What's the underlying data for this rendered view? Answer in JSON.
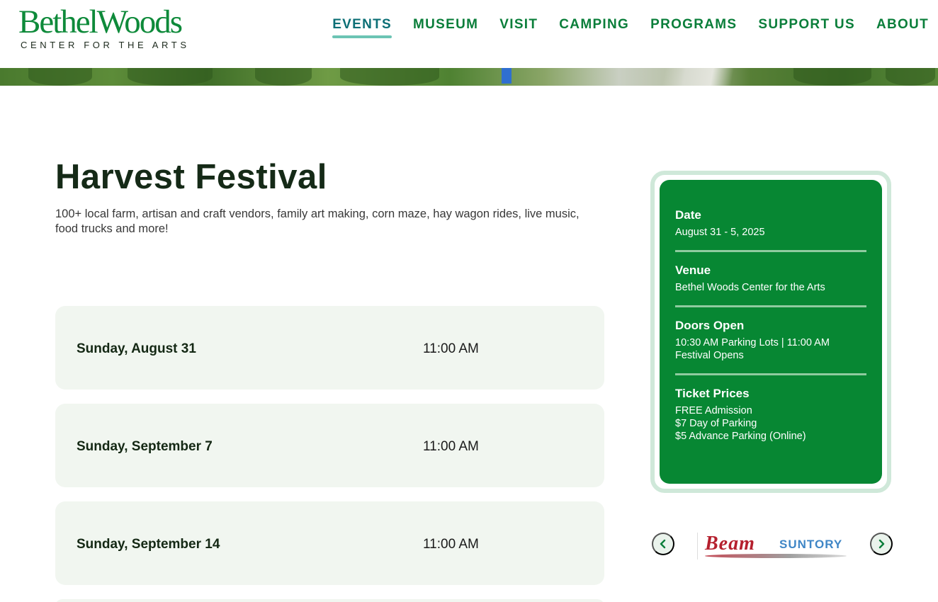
{
  "brand": {
    "name": "BethelWoods",
    "tagline": "CENTER FOR THE ARTS"
  },
  "nav": {
    "items": [
      {
        "label": "EVENTS",
        "active": true
      },
      {
        "label": "MUSEUM"
      },
      {
        "label": "VISIT"
      },
      {
        "label": "CAMPING"
      },
      {
        "label": "PROGRAMS"
      },
      {
        "label": "SUPPORT US"
      },
      {
        "label": "ABOUT"
      }
    ]
  },
  "event": {
    "title": "Harvest Festival",
    "description": "100+ local farm, artisan and craft vendors, family art making, corn maze, hay wagon rides, live music, food trucks and more!"
  },
  "dates": [
    {
      "day": "Sunday, August 31",
      "time": "11:00 AM"
    },
    {
      "day": "Sunday, September 7",
      "time": "11:00 AM"
    },
    {
      "day": "Sunday, September 14",
      "time": "11:00 AM"
    }
  ],
  "info": {
    "date_label": "Date",
    "date_value": "August 31 - 5, 2025",
    "venue_label": "Venue",
    "venue_value": "Bethel Woods Center for the Arts",
    "doors_label": "Doors Open",
    "doors_value": "10:30 AM Parking Lots | 11:00 AM Festival Opens",
    "tickets_label": "Ticket Prices",
    "tickets_lines": [
      "FREE Admission",
      "$7 Day of Parking",
      "$5 Advance Parking (Online)"
    ]
  },
  "sponsor": {
    "logo_text_1": "Beam",
    "logo_text_2": "SUNTORY"
  },
  "colors": {
    "brand_green": "#0a7e3a",
    "card_green": "#078733",
    "active_teal": "#0c6f76"
  },
  "icons": {
    "prev": "chevron-left-icon",
    "next": "chevron-right-icon"
  }
}
